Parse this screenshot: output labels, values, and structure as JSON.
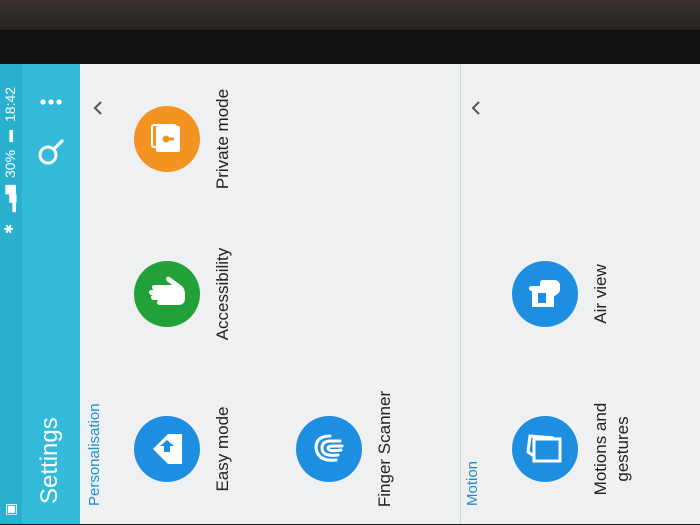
{
  "status_bar": {
    "time": "18:42",
    "battery": "30%"
  },
  "header": {
    "title": "Settings"
  },
  "sections": [
    {
      "title": "Personalisation",
      "items": [
        {
          "label": "Easy mode",
          "icon": "easy-mode-icon",
          "color": "#1e8fe0"
        },
        {
          "label": "Accessibility",
          "icon": "hand-icon",
          "color": "#22a138"
        },
        {
          "label": "Private mode",
          "icon": "lock-folder-icon",
          "color": "#f29322"
        },
        {
          "label": "Finger Scanner",
          "icon": "fingerprint-icon",
          "color": "#1e8fe0"
        }
      ]
    },
    {
      "title": "Motion",
      "items": [
        {
          "label": "Motions and gestures",
          "icon": "motion-icon",
          "color": "#1e8fe0"
        },
        {
          "label": "Air view",
          "icon": "air-view-icon",
          "color": "#1e8fe0"
        }
      ]
    }
  ],
  "colors": {
    "action_bar": "#34bbd9",
    "section_title": "#1d8fd0"
  }
}
